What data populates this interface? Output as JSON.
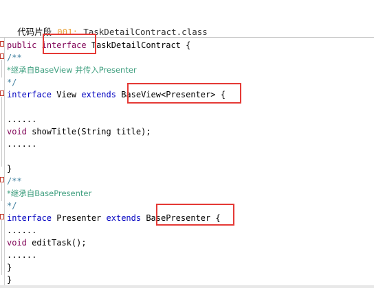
{
  "header": {
    "label": "代码片段",
    "number": "001:",
    "filename": "TaskDetailContract.class"
  },
  "code": {
    "l1_public": "public",
    "l1_interface": "interface",
    "l1_rest": " TaskDetailContract {",
    "l2": "/**",
    "l3": "*继承自BaseView 并传入Presenter",
    "l4": "*/",
    "l5_interface": "interface",
    "l5_name": " View ",
    "l5_extends": "extends",
    "l5_type": "BaseView<Presenter>",
    "l5_brace": " {",
    "l6": "",
    "l7": "......",
    "l8_void": "void",
    "l8_rest": " showTitle(String title);",
    "l9": "......",
    "l10": "",
    "l11": "}",
    "l12": "/**",
    "l13": "*继承自BasePresenter",
    "l14": "*/",
    "l15_interface": "interface",
    "l15_name": " Presenter ",
    "l15_extends": "extends",
    "l15_type": "BasePresenter",
    "l15_brace": " {",
    "l16": "......",
    "l17_void": "void",
    "l17_rest": " editTask();",
    "l18": "......",
    "l19": "}",
    "l20": "}"
  },
  "colors": {
    "keyword": "#7f0055",
    "comment": "#3f7f9f",
    "highlight": "#e53935",
    "number": "#e8a33b"
  }
}
